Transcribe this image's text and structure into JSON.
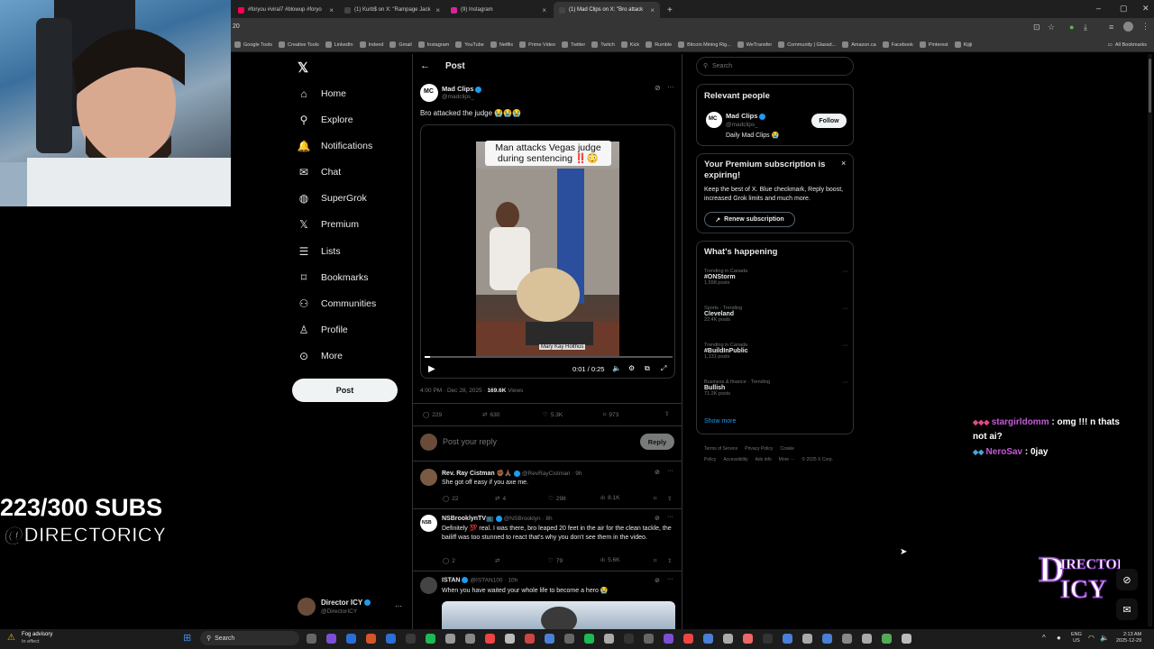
{
  "browser": {
    "tabs": [
      {
        "title": "#foryou #viral7 #blowup #foryo",
        "color": "#ff0050"
      },
      {
        "title": "(1) Kurb$ on X: \"Rampage Jack",
        "color": "#444"
      },
      {
        "title": "(9) Instagram",
        "color": "#d6249f"
      },
      {
        "title": "(1) Mad Clips on X: \"Bro attack",
        "color": "#444"
      }
    ],
    "address_text": "20",
    "bookmarks": [
      "Google Tools",
      "Creative Tools",
      "LinkedIn",
      "Indeed",
      "Gmail",
      "Instagram",
      "YouTube",
      "Netflix",
      "Prime Video",
      "Twitter",
      "Twitch",
      "Kick",
      "Rumble",
      "Bitcoin Mining Rig...",
      "WeTransfer",
      "Community | Glassd...",
      "Amazon.ca",
      "Facebook",
      "Pinterest",
      "Kijiji"
    ],
    "all_bookmarks": "All Bookmarks"
  },
  "overlay": {
    "subs": "223/300 SUBS",
    "handle": "@DIRECTORICY",
    "chat": [
      {
        "user": "stargirldomm",
        "msg": " : omg !!! n thats not ai?"
      },
      {
        "user": "NeroSav",
        "msg": " : 0jay"
      }
    ]
  },
  "nav": {
    "items": [
      {
        "label": "Home",
        "icon": "home-icon",
        "glyph": "⌂"
      },
      {
        "label": "Explore",
        "icon": "search-icon",
        "glyph": "⚲"
      },
      {
        "label": "Notifications",
        "icon": "bell-icon",
        "glyph": "🔔"
      },
      {
        "label": "Chat",
        "icon": "mail-icon",
        "glyph": "✉"
      },
      {
        "label": "SuperGrok",
        "icon": "grok-icon",
        "glyph": "◍"
      },
      {
        "label": "Premium",
        "icon": "x-icon",
        "glyph": "𝕏"
      },
      {
        "label": "Lists",
        "icon": "list-icon",
        "glyph": "☰"
      },
      {
        "label": "Bookmarks",
        "icon": "bookmark-icon",
        "glyph": "⌑"
      },
      {
        "label": "Communities",
        "icon": "people-icon",
        "glyph": "⚇"
      },
      {
        "label": "Profile",
        "icon": "person-icon",
        "glyph": "♙"
      },
      {
        "label": "More",
        "icon": "more-circle-icon",
        "glyph": "⊙"
      }
    ],
    "post_label": "Post",
    "account_name": "Director ICY",
    "account_handle": "@DirectorICY"
  },
  "post": {
    "header": "Post",
    "author": "Mad Clips",
    "handle": "@madclips_",
    "text": "Bro attacked the judge 😭😭😭",
    "video_caption": "Man attacks Vegas judge during sentencing ‼️😳",
    "video_lower": "Mary Kay Holthus",
    "video_time": "0:01 / 0:25",
    "timestamp": "4:00 PM · Dec 28, 2025 · ",
    "views": "169.6K",
    "views_label": " Views",
    "replies": "229",
    "reposts": "630",
    "likes": "5.3K",
    "bookmarks": "973",
    "reply_placeholder": "Post your reply",
    "reply_button": "Reply"
  },
  "replies": [
    {
      "name": "Rev. Ray Cistman ✊🏾🙏🏾",
      "handle": "@RevRayCistman · 9h",
      "text": "She got off easy if you axe me.",
      "replies": "22",
      "reposts": "4",
      "likes": "298",
      "views": "8.1K"
    },
    {
      "name": "NSBrooklynTV📺",
      "handle": "@NSBrooklyn · 8h",
      "text": "Definitely 💯 real. I was there, bro leaped 20 feet in the air for the clean tackle, the bailiff was too stunned to react that's why you don't see them in the video.",
      "replies": "2",
      "reposts": "",
      "likes": "79",
      "views": "5.6K"
    },
    {
      "name": "ISTAN",
      "handle": "@ISTAN100 · 10h",
      "text": "When you have waited your whole life to become a hero 😭"
    }
  ],
  "sidebar": {
    "search_placeholder": "Search",
    "relevant_title": "Relevant people",
    "relevant_name": "Mad Clips",
    "relevant_handle": "@madclips_",
    "relevant_bio": "Daily Mad Clips 😭",
    "follow_label": "Follow",
    "premium_title": "Your Premium subscription is expiring!",
    "premium_body": "Keep the best of X. Blue checkmark, Reply boost, increased Grok limits and much more.",
    "renew_label": "Renew subscription",
    "happening_title": "What's happening",
    "trends": [
      {
        "meta": "Trending in Canada",
        "name": "#ONStorm",
        "count": "1,598 posts"
      },
      {
        "meta": "Sports · Trending",
        "name": "Cleveland",
        "count": "22.4K posts"
      },
      {
        "meta": "Trending in Canada",
        "name": "#BuildInPublic",
        "count": "1,131 posts"
      },
      {
        "meta": "Business & finance · Trending",
        "name": "Bullish",
        "count": "71.2K posts"
      }
    ],
    "show_more": "Show more",
    "footer": [
      "Terms of Service",
      "Privacy Policy",
      "Cookie Policy",
      "Accessibility",
      "Ads info",
      "More ···",
      "© 2025 X Corp."
    ]
  },
  "taskbar": {
    "weather_title": "Fog advisory",
    "weather_sub": "In effect",
    "search": "Search",
    "lang1": "ENG",
    "lang2": "US",
    "time": "2:13 AM",
    "date": "2025-12-29"
  },
  "colors": {
    "accent": "#1d9bf0",
    "chat_user": "#c45ad8"
  }
}
